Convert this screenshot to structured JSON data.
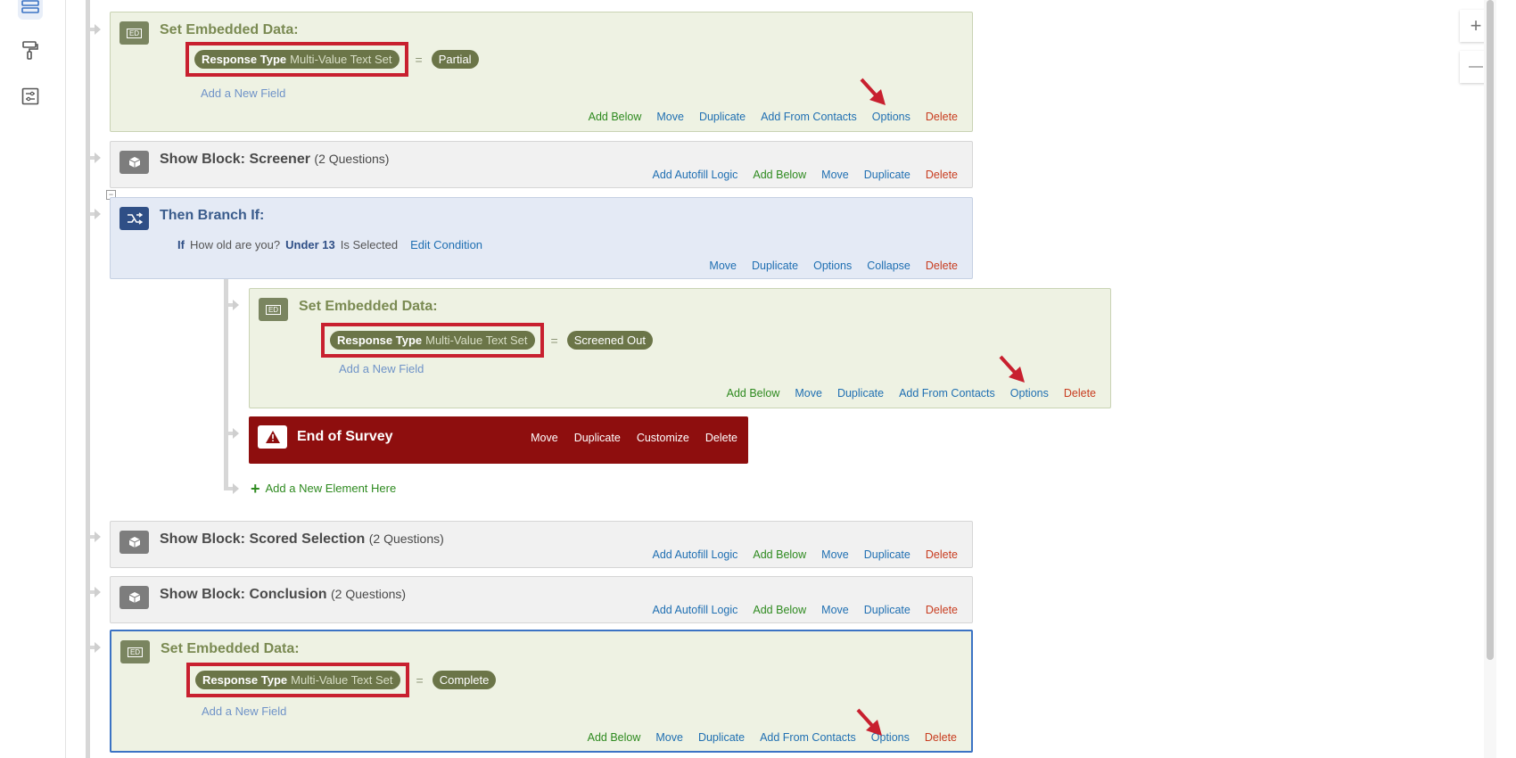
{
  "sidebar": {
    "icons": [
      "survey-flow-icon",
      "paint-roller-icon",
      "survey-options-icon"
    ]
  },
  "common": {
    "set_embedded_title": "Set Embedded Data:",
    "field_name": "Response Type",
    "field_type": "Multi-Value Text Set",
    "equals": "=",
    "add_field": "Add a New Field",
    "add_below": "Add Below",
    "move": "Move",
    "duplicate": "Duplicate",
    "add_from_contacts": "Add From Contacts",
    "options": "Options",
    "delete": "Delete",
    "add_autofill": "Add Autofill Logic",
    "collapse": "Collapse",
    "customize": "Customize"
  },
  "embedded1": {
    "value": "Partial"
  },
  "block_screener": {
    "title": "Show Block: Screener",
    "count": "(2 Questions)"
  },
  "branch": {
    "title": "Then Branch If:",
    "if": "If",
    "question": "How old are you?",
    "choice": "Under 13",
    "operator": "Is Selected",
    "edit": "Edit Condition"
  },
  "embedded2": {
    "value": "Screened Out"
  },
  "end_of_survey": {
    "title": "End of Survey"
  },
  "add_element": "Add a New Element Here",
  "block_scored": {
    "title": "Show Block: Scored Selection",
    "count": "(2 Questions)"
  },
  "block_conclusion": {
    "title": "Show Block: Conclusion",
    "count": "(2 Questions)"
  },
  "embedded3": {
    "value": "Complete"
  },
  "zoom": {
    "in": "+",
    "out": "—"
  },
  "colors": {
    "embedded_bg": "#eef2e3",
    "branch_bg": "#e4eaf5",
    "end_bg": "#8e0e0e",
    "highlight_red": "#c8202f",
    "selected_border": "#3b73c4"
  }
}
